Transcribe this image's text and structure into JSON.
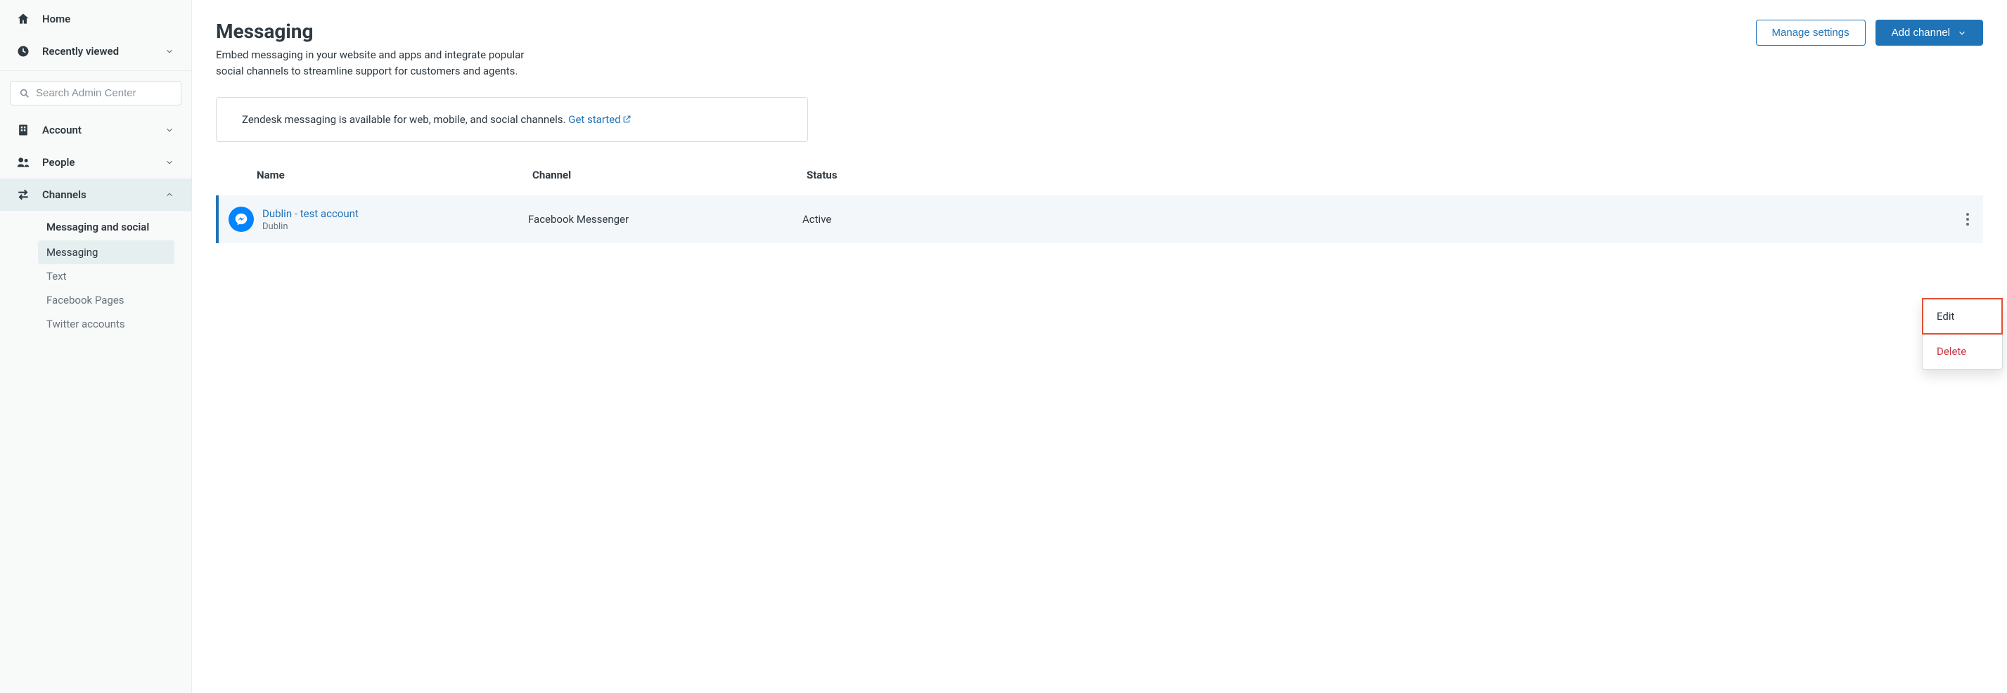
{
  "sidebar": {
    "home": "Home",
    "recent": "Recently viewed",
    "search_placeholder": "Search Admin Center",
    "account": "Account",
    "people": "People",
    "channels": "Channels",
    "sub_group_title": "Messaging and social",
    "sub_items": {
      "messaging": "Messaging",
      "text": "Text",
      "facebook_pages": "Facebook Pages",
      "twitter_accounts": "Twitter accounts"
    }
  },
  "header": {
    "title": "Messaging",
    "description": "Embed messaging in your website and apps and integrate popular social channels to streamline support for customers and agents.",
    "manage_settings": "Manage settings",
    "add_channel": "Add channel"
  },
  "banner": {
    "text": "Zendesk messaging is available for web, mobile, and social channels. ",
    "link": "Get started"
  },
  "table": {
    "columns": {
      "name": "Name",
      "channel": "Channel",
      "status": "Status"
    },
    "rows": [
      {
        "name": "Dublin - test account",
        "sub": "Dublin",
        "channel": "Facebook Messenger",
        "status": "Active"
      }
    ]
  },
  "menu": {
    "edit": "Edit",
    "delete": "Delete"
  }
}
